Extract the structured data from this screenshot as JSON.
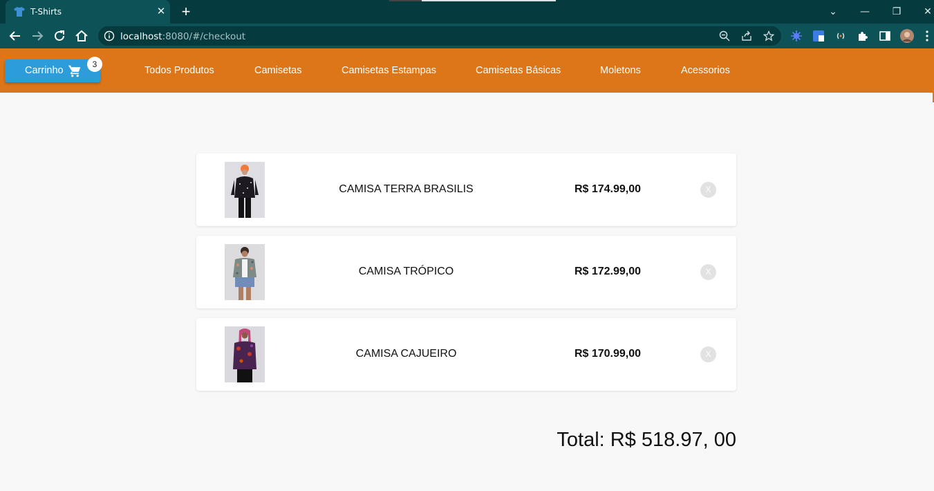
{
  "browser": {
    "tab_title": "T-Shirts",
    "tab_close": "✕",
    "new_tab": "+",
    "url_host": "localhost",
    "url_rest": ":8080/#/checkout",
    "window_controls": {
      "minimize": "—",
      "restore": "❐",
      "close": "✕",
      "tab_search": "⌄"
    }
  },
  "header": {
    "cart_label": "Carrinho",
    "cart_count": "3",
    "menu": [
      "Todos Produtos",
      "Camisetas",
      "Camisetas Estampas",
      "Camisetas Básicas",
      "Moletons",
      "Acessorios"
    ]
  },
  "cart": {
    "items": [
      {
        "name": "CAMISA TERRA BRASILIS",
        "price": "R$ 174.99,00",
        "remove": "X"
      },
      {
        "name": "CAMISA TRÓPICO",
        "price": "R$ 172.99,00",
        "remove": "X"
      },
      {
        "name": "CAMISA CAJUEIRO",
        "price": "R$ 170.99,00",
        "remove": "X"
      }
    ],
    "total": "Total: R$ 518.97, 00"
  },
  "colors": {
    "header": "#dc7619",
    "cart_button": "#2d9cdb",
    "browser_frame": "#053a3e",
    "browser_toolbar": "#0c5257"
  },
  "icons": {
    "tab_favicon": "tshirt-icon",
    "cart": "cart-icon",
    "back": "back-arrow-icon",
    "forward": "forward-arrow-icon",
    "reload": "reload-icon",
    "home": "home-icon",
    "site_info": "info-icon",
    "zoom": "zoom-icon",
    "share": "share-icon",
    "bookmark": "star-icon"
  }
}
